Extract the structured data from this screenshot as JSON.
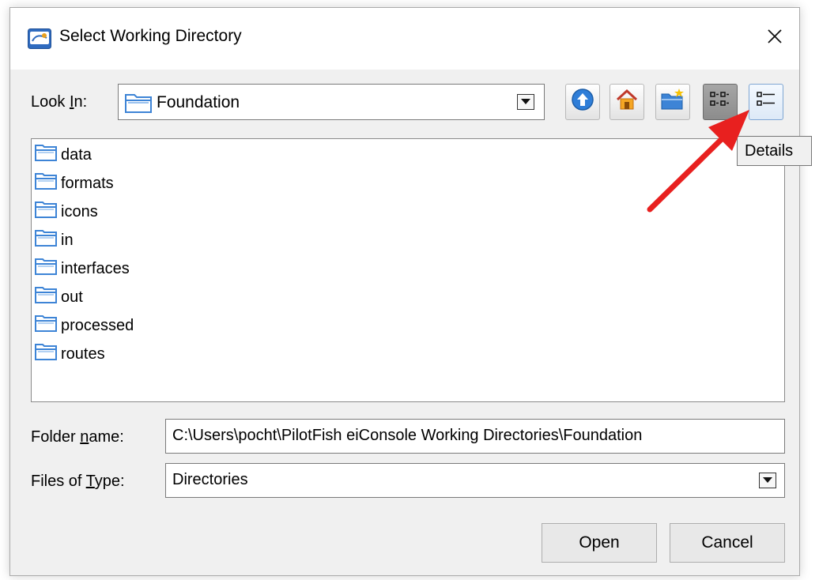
{
  "dialog": {
    "title": "Select Working Directory",
    "close_glyph": "✕"
  },
  "look_in": {
    "label_pre": "Look ",
    "label_mnemonic": "I",
    "label_post": "n:",
    "value": "Foundation"
  },
  "toolbar": {
    "buttons": [
      {
        "name": "up-one-level",
        "icon": "up-arrow-icon"
      },
      {
        "name": "home",
        "icon": "home-icon"
      },
      {
        "name": "create-new-folder",
        "icon": "new-folder-icon"
      },
      {
        "name": "list",
        "icon": "list-view-icon",
        "selected": true
      },
      {
        "name": "details",
        "icon": "details-view-icon",
        "hovered": true
      }
    ],
    "tooltip": "Details"
  },
  "files": [
    {
      "label": "data",
      "icon": "folder-icon"
    },
    {
      "label": "formats",
      "icon": "folder-icon"
    },
    {
      "label": "icons",
      "icon": "folder-icon"
    },
    {
      "label": "in",
      "icon": "folder-icon"
    },
    {
      "label": "interfaces",
      "icon": "folder-icon"
    },
    {
      "label": "out",
      "icon": "folder-icon"
    },
    {
      "label": "processed",
      "icon": "folder-icon"
    },
    {
      "label": "routes",
      "icon": "folder-icon"
    }
  ],
  "folder_name": {
    "label_pre": "Folder ",
    "label_mnemonic": "n",
    "label_post": "ame:",
    "value": "C:\\Users\\pocht\\PilotFish eiConsole Working Directories\\Foundation"
  },
  "files_of_type": {
    "label_pre": "Files of ",
    "label_mnemonic": "T",
    "label_post": "ype:",
    "value": "Directories"
  },
  "buttons": {
    "open": "Open",
    "cancel": "Cancel"
  },
  "colors": {
    "annotation_arrow": "#e8201f",
    "folder_icon": "#3d84d6"
  }
}
